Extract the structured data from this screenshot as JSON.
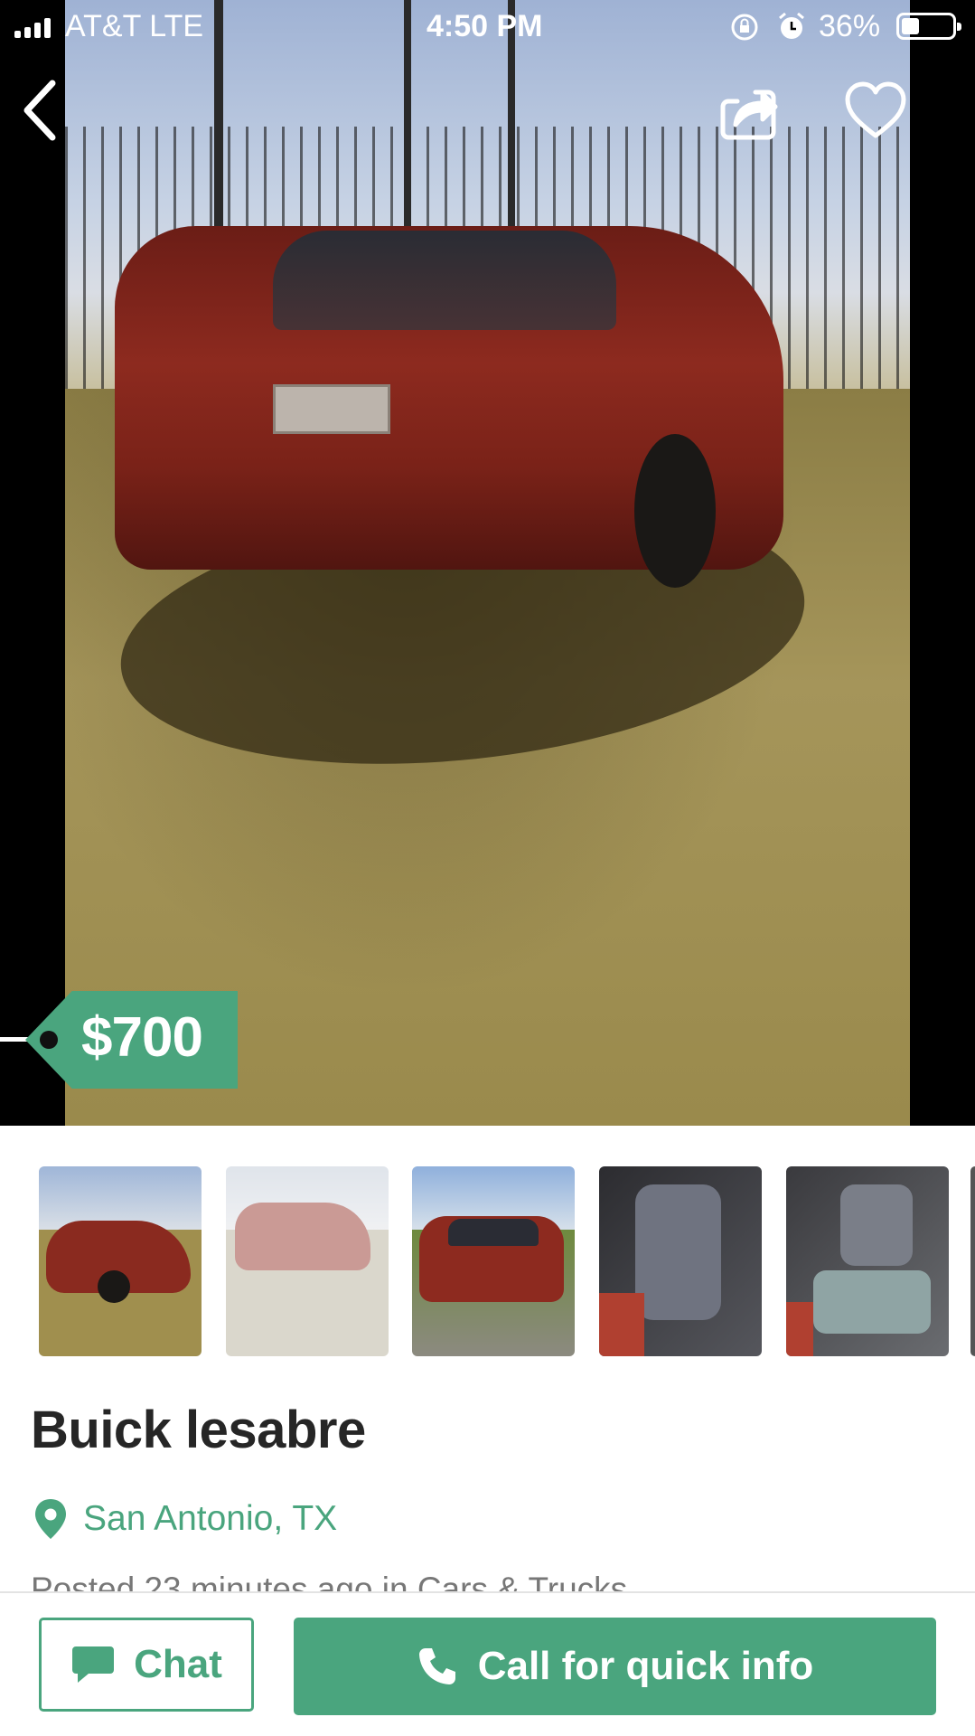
{
  "status_bar": {
    "carrier": "AT&T  LTE",
    "time": "4:50 PM",
    "battery_percent": "36%",
    "battery_level": 0.36
  },
  "hero": {
    "image_subject": "red sedan parked on grass, rear view",
    "icons": {
      "back": "chevron-left-icon",
      "share": "share-icon",
      "favorite": "heart-icon"
    }
  },
  "listing": {
    "price": "$700",
    "title": "Buick lesabre",
    "location": "San Antonio, TX",
    "posted": "Posted 23 minutes ago in Cars & Trucks"
  },
  "thumbnails": [
    {
      "subject": "car side view on grass"
    },
    {
      "subject": "car rear view (faded)"
    },
    {
      "subject": "car front view"
    },
    {
      "subject": "rear seats interior"
    },
    {
      "subject": "front seats interior"
    }
  ],
  "actions": {
    "chat_label": "Chat",
    "call_label": "Call for quick info"
  },
  "colors": {
    "accent_green": "#4aa57e",
    "title_text": "#262626",
    "muted_text": "#777777"
  }
}
